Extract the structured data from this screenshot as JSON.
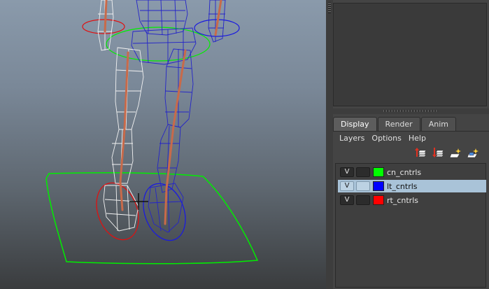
{
  "panel": {
    "tabs": [
      {
        "label": "Display",
        "active": true
      },
      {
        "label": "Render",
        "active": false
      },
      {
        "label": "Anim",
        "active": false
      }
    ],
    "menu": [
      "Layers",
      "Options",
      "Help"
    ],
    "toolbar_icons": [
      "move-layer-up-icon",
      "move-layer-down-icon",
      "new-layer-icon",
      "new-layer-from-selected-icon"
    ]
  },
  "layers": [
    {
      "visible_label": "V",
      "name": "cn_cntrls",
      "color": "#00ff00",
      "selected": false
    },
    {
      "visible_label": "V",
      "name": "lt_cntrls",
      "color": "#0000ff",
      "selected": true
    },
    {
      "visible_label": "V",
      "name": "rt_cntrls",
      "color": "#ff0000",
      "selected": false
    }
  ],
  "colors": {
    "selection": "#a9c3d8",
    "cn_controls": "#00ff00",
    "lt_controls": "#0000ff",
    "rt_controls": "#ff0000",
    "joint": "#c86a4a"
  }
}
